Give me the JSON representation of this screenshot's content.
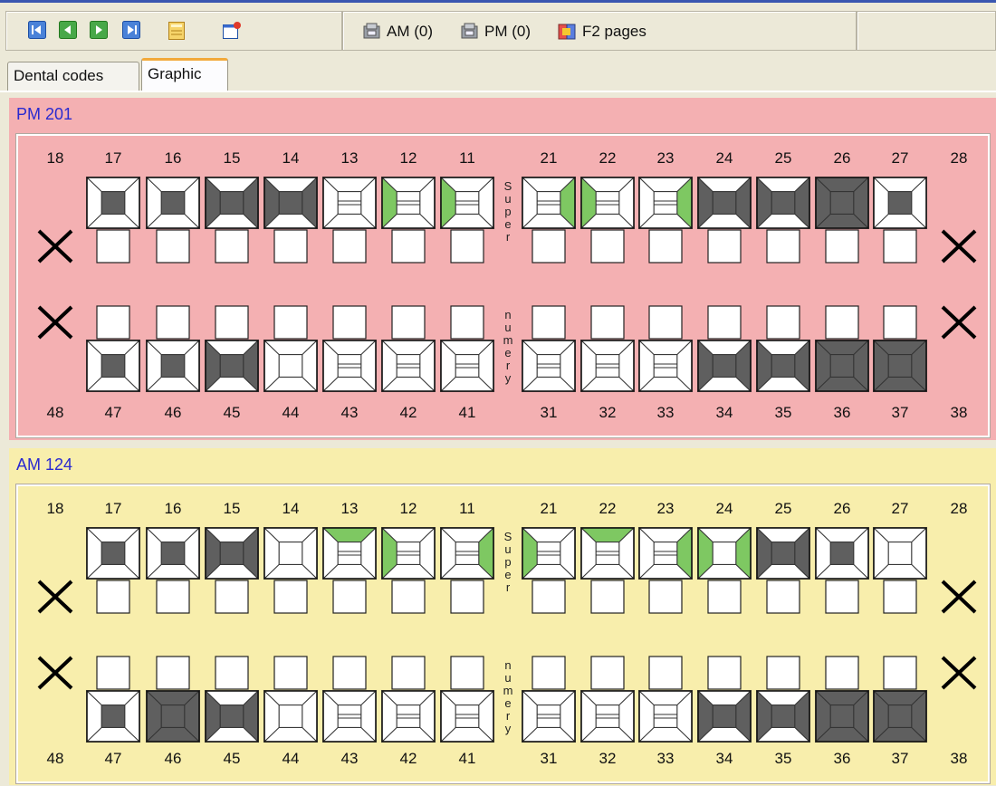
{
  "toolbar": {
    "nav_buttons": [
      "first-record-icon",
      "previous-record-icon",
      "next-record-icon",
      "last-record-icon",
      "notepad-icon",
      "new-window-icon"
    ],
    "status": [
      {
        "icon": "appointment-book-icon",
        "label": "AM (0)"
      },
      {
        "icon": "appointment-book-icon",
        "label": "PM (0)"
      },
      {
        "icon": "pages-icon",
        "label": "F2 pages"
      }
    ]
  },
  "tabs": [
    {
      "label": "Dental codes",
      "active": false
    },
    {
      "label": "Graphic",
      "active": true
    }
  ],
  "charts": [
    {
      "title": "PM 201",
      "background": "#f4b0b2",
      "upper_labels": [
        "18",
        "17",
        "16",
        "15",
        "14",
        "13",
        "12",
        "11",
        "21",
        "22",
        "23",
        "24",
        "25",
        "26",
        "27",
        "28"
      ],
      "lower_labels": [
        "48",
        "47",
        "46",
        "45",
        "44",
        "43",
        "42",
        "41",
        "31",
        "32",
        "33",
        "34",
        "35",
        "36",
        "37",
        "38"
      ],
      "upper_teeth": [
        "X",
        "dark",
        "dark",
        "dark-h",
        "dark-h",
        "open",
        "green-m",
        "green-m",
        "green-d",
        "green-m",
        "green-d",
        "dark-h",
        "dark-h",
        "full",
        "dark",
        "X"
      ],
      "lower_teeth": [
        "X",
        "dark",
        "dark",
        "dark-h",
        "open-box",
        "open",
        "open",
        "open",
        "open",
        "open",
        "open",
        "dark-h",
        "dark-h",
        "full",
        "full",
        "X"
      ],
      "divider_text": [
        "S",
        "u",
        "p",
        "e",
        "r",
        "n",
        "u",
        "m",
        "e",
        "r",
        "y"
      ]
    },
    {
      "title": "AM 124",
      "background": "#f8eeac",
      "upper_labels": [
        "18",
        "17",
        "16",
        "15",
        "14",
        "13",
        "12",
        "11",
        "21",
        "22",
        "23",
        "24",
        "25",
        "26",
        "27",
        "28"
      ],
      "lower_labels": [
        "48",
        "47",
        "46",
        "45",
        "44",
        "43",
        "42",
        "41",
        "31",
        "32",
        "33",
        "34",
        "35",
        "36",
        "37",
        "38"
      ],
      "upper_teeth": [
        "X",
        "dark",
        "dark",
        "dark-h",
        "open-box",
        "green-top",
        "green-m",
        "green-d",
        "green-m",
        "green-top",
        "green-d",
        "green-box",
        "dark-h",
        "dark",
        "open-box",
        "X"
      ],
      "lower_teeth": [
        "X",
        "dark",
        "full",
        "dark-h",
        "open-box",
        "open",
        "open",
        "open",
        "open",
        "open",
        "open",
        "dark-h",
        "dark-h",
        "full",
        "full",
        "X"
      ],
      "divider_text": [
        "S",
        "u",
        "p",
        "e",
        "r",
        "n",
        "u",
        "m",
        "e",
        "r",
        "y"
      ]
    }
  ],
  "colors": {
    "accent_blue": "#2a2ad0",
    "restoration_dark": "#5f5f5f",
    "restoration_green": "#7ec862",
    "toolbar_bg": "#ece9d8"
  }
}
